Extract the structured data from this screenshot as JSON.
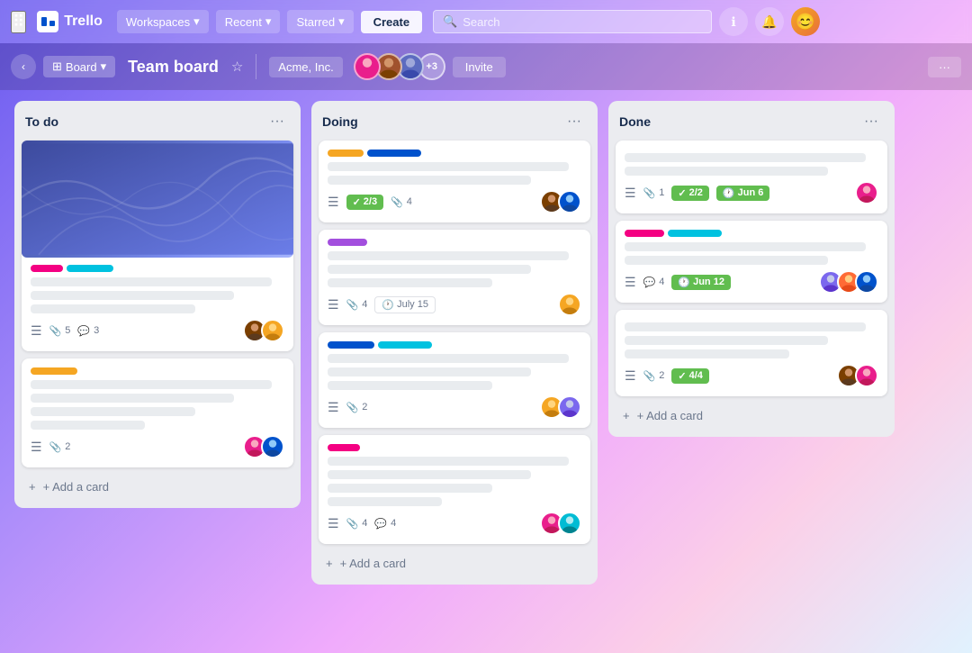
{
  "app": {
    "name": "Trello",
    "title": "Team board"
  },
  "nav": {
    "workspaces": "Workspaces",
    "recent": "Recent",
    "starred": "Starred",
    "create": "Create",
    "search_placeholder": "Search",
    "board_view": "Board",
    "board_title": "Team board",
    "workspace_name": "Acme, Inc.",
    "member_count": "+3",
    "invite": "Invite",
    "more": "···"
  },
  "columns": [
    {
      "id": "todo",
      "title": "To do",
      "cards": [
        {
          "id": "card1",
          "has_cover": true,
          "labels": [
            {
              "color": "#f40082",
              "width": 36
            },
            {
              "color": "#00c2e0",
              "width": 52
            }
          ],
          "lines": [
            "long",
            "medium",
            "short"
          ],
          "footer": {
            "menu": true,
            "clip": 5,
            "comment": 3
          },
          "avatars": [
            "brown",
            "yellow"
          ]
        },
        {
          "id": "card2",
          "has_cover": false,
          "labels": [
            {
              "color": "#f5a623",
              "width": 52
            }
          ],
          "lines": [
            "long",
            "medium",
            "short",
            "xshort"
          ],
          "footer": {
            "menu": true,
            "clip": 2
          },
          "avatars": [
            "pink",
            "blue"
          ]
        }
      ],
      "add_label": "+ Add a card"
    },
    {
      "id": "doing",
      "title": "Doing",
      "cards": [
        {
          "id": "card3",
          "has_cover": false,
          "labels": [
            {
              "color": "#f5a623",
              "width": 40
            },
            {
              "color": "#0052cc",
              "width": 60
            }
          ],
          "lines": [
            "long",
            "medium"
          ],
          "footer": {
            "menu": true,
            "clip": null,
            "check": "2/3",
            "attach": 4
          },
          "avatars": [
            "brown",
            "blue"
          ]
        },
        {
          "id": "card4",
          "has_cover": false,
          "labels": [
            {
              "color": "#a34fde",
              "width": 44
            }
          ],
          "lines": [
            "long",
            "medium",
            "short"
          ],
          "footer": {
            "menu": true,
            "clip": 4,
            "date": "July 15"
          },
          "avatars": [
            "yellow"
          ]
        },
        {
          "id": "card5",
          "has_cover": false,
          "labels": [
            {
              "color": "#0052cc",
              "width": 52
            },
            {
              "color": "#00c2e0",
              "width": 60
            }
          ],
          "lines": [
            "long",
            "medium",
            "short"
          ],
          "footer": {
            "menu": true,
            "clip": 2
          },
          "avatars": [
            "yellow",
            "purple"
          ]
        },
        {
          "id": "card6",
          "has_cover": false,
          "labels": [
            {
              "color": "#f40082",
              "width": 36
            }
          ],
          "lines": [
            "long",
            "medium",
            "short",
            "xshort"
          ],
          "footer": {
            "menu": true,
            "clip": 4,
            "comment": 4
          },
          "avatars": [
            "pink",
            "teal"
          ]
        }
      ],
      "add_label": "+ Add a card"
    },
    {
      "id": "done",
      "title": "Done",
      "cards": [
        {
          "id": "card7",
          "has_cover": false,
          "labels": [],
          "lines": [
            "long",
            "medium"
          ],
          "footer": {
            "menu": true,
            "clip": 1,
            "check": "2/2",
            "date_green": "Jun 6"
          },
          "avatars": [
            "pink"
          ]
        },
        {
          "id": "card8",
          "has_cover": false,
          "labels": [
            {
              "color": "#f40082",
              "width": 44
            },
            {
              "color": "#00c2e0",
              "width": 60
            }
          ],
          "lines": [
            "long",
            "medium"
          ],
          "footer": {
            "menu": true,
            "comment": 4,
            "date_green": "Jun 12"
          },
          "avatars": [
            "purple",
            "orange",
            "blue"
          ]
        },
        {
          "id": "card9",
          "has_cover": false,
          "labels": [],
          "lines": [
            "long",
            "medium",
            "short"
          ],
          "footer": {
            "menu": true,
            "clip": 2,
            "check": "4/4"
          },
          "avatars": [
            "brown",
            "pink"
          ]
        }
      ],
      "add_label": "+ Add a card"
    }
  ]
}
